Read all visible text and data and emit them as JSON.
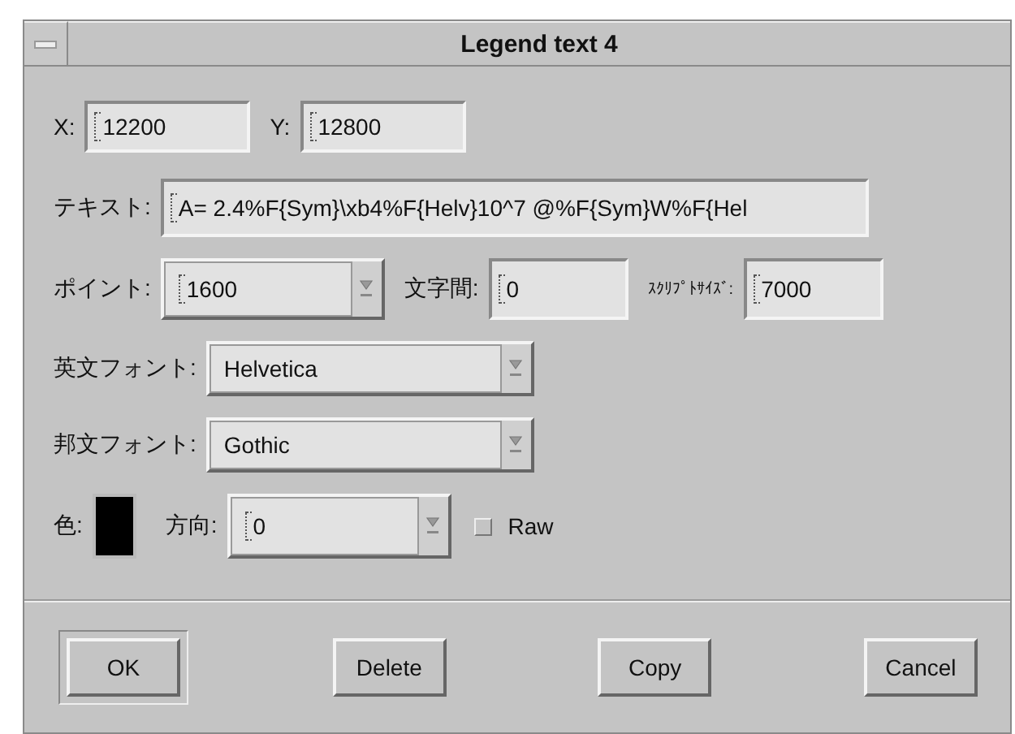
{
  "window": {
    "title": "Legend text 4"
  },
  "position": {
    "x": {
      "label": "X:",
      "value": "12200"
    },
    "y": {
      "label": "Y:",
      "value": "12800"
    }
  },
  "text": {
    "label": "テキスト:",
    "value": "A= 2.4%F{Sym}\\xb4%F{Helv}10^7 @%F{Sym}W%F{Hel"
  },
  "point": {
    "label": "ポイント:",
    "value": "1600"
  },
  "spacing": {
    "label": "文字間:",
    "value": "0"
  },
  "script_size": {
    "label": "ｽｸﾘﾌﾟﾄｻｲｽﾞ:",
    "value": "7000"
  },
  "latin_font": {
    "label": "英文フォント:",
    "value": "Helvetica"
  },
  "japanese_font": {
    "label": "邦文フォント:",
    "value": "Gothic"
  },
  "color": {
    "label": "色:",
    "color": "#000000"
  },
  "direction": {
    "label": "方向:",
    "value": "0"
  },
  "raw": {
    "label": "Raw",
    "checked": false
  },
  "buttons": [
    {
      "label": "OK",
      "default": true
    },
    {
      "label": "Delete",
      "default": false
    },
    {
      "label": "Copy",
      "default": false
    },
    {
      "label": "Cancel",
      "default": false
    }
  ]
}
